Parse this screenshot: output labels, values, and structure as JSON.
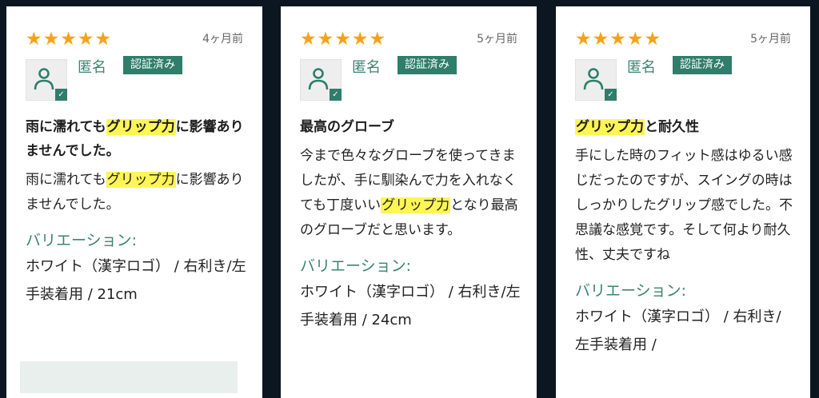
{
  "reviews": [
    {
      "date": "4ヶ月前",
      "rating": "★★★★★",
      "user": "匿名",
      "badge": "認証済み",
      "title_pre": "雨に濡れても",
      "title_hl": "グリップ力",
      "title_post": "に影響ありませんでした。",
      "body_pre": "雨に濡れても",
      "body_hl": "グリップ力",
      "body_post": "に影響ありませんでした。",
      "variation_label": "バリエーション:",
      "variation_value": "ホワイト（漢字ロゴ） / 右利き/左手装着用 / 21cm"
    },
    {
      "date": "5ヶ月前",
      "rating": "★★★★★",
      "user": "匿名",
      "badge": "認証済み",
      "title": "最高のグローブ",
      "body_pre": "今まで色々なグローブを使ってきましたが、手に馴染んで力を入れなくても丁度いい",
      "body_hl": "グリップ力",
      "body_post": "となり最高のグローブだと思います。",
      "variation_label": "バリエーション:",
      "variation_value": "ホワイト（漢字ロゴ） / 右利き/左手装着用 / 24cm"
    },
    {
      "date": "5ヶ月前",
      "rating": "★★★★★",
      "user": "匿名",
      "badge": "認証済み",
      "title_hl": "グリップ力",
      "title_post": "と耐久性",
      "body": "手にした時のフィット感はゆるい感じだったのですが、スイングの時はしっかりしたグリップ感でした。不思議な感覚です。そして何より耐久性、丈夫ですね",
      "variation_label": "バリエーション:",
      "variation_value": "ホワイト（漢字ロゴ） / 右利き/左手装着用 /"
    }
  ],
  "colors": {
    "star": "#f5a21b",
    "accent": "#2f7d6a",
    "highlight": "#fff555",
    "background": "#0b1620"
  },
  "icons": {
    "avatar": "user-icon",
    "verified": "check-icon",
    "rating": "star-icon"
  }
}
